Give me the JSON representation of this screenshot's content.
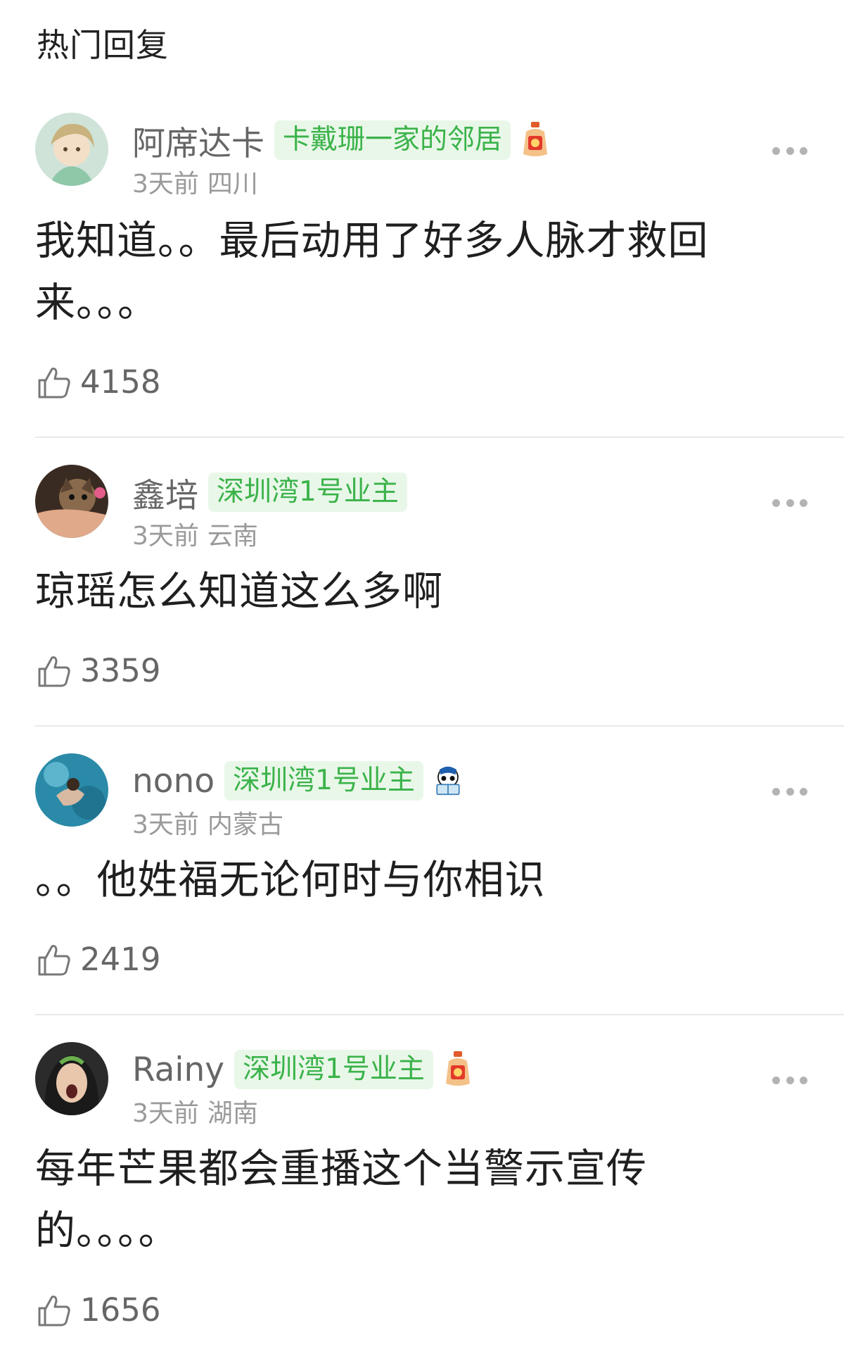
{
  "section_title": "热门回复",
  "colors": {
    "badge_bg": "#e9f7e9",
    "badge_text": "#3bb34a",
    "meta": "#9a9a9a"
  },
  "comments": [
    {
      "username": "阿席达卡",
      "badge": "卡戴珊一家的邻居",
      "decoration": "lucky-bag-icon",
      "time": "3天前",
      "location": "四川",
      "text_lines": [
        "我知道。。最后动用了好多人脉才救回",
        "来。。。"
      ],
      "likes": "4158"
    },
    {
      "username": "鑫培",
      "badge": "深圳湾1号业主",
      "decoration": "",
      "time": "3天前",
      "location": "云南",
      "text_lines": [
        "琼瑶怎么知道这么多啊"
      ],
      "likes": "3359"
    },
    {
      "username": "nono",
      "badge": "深圳湾1号业主",
      "decoration": "reading-panda-icon",
      "time": "3天前",
      "location": "内蒙古",
      "text_lines": [
        "。。他姓福无论何时与你相识"
      ],
      "likes": "2419"
    },
    {
      "username": "Rainy",
      "badge": "深圳湾1号业主",
      "decoration": "lucky-bag-icon",
      "time": "3天前",
      "location": "湖南",
      "text_lines": [
        "每年芒果都会重播这个当警示宣传",
        "的。。。。"
      ],
      "likes": "1656"
    }
  ]
}
